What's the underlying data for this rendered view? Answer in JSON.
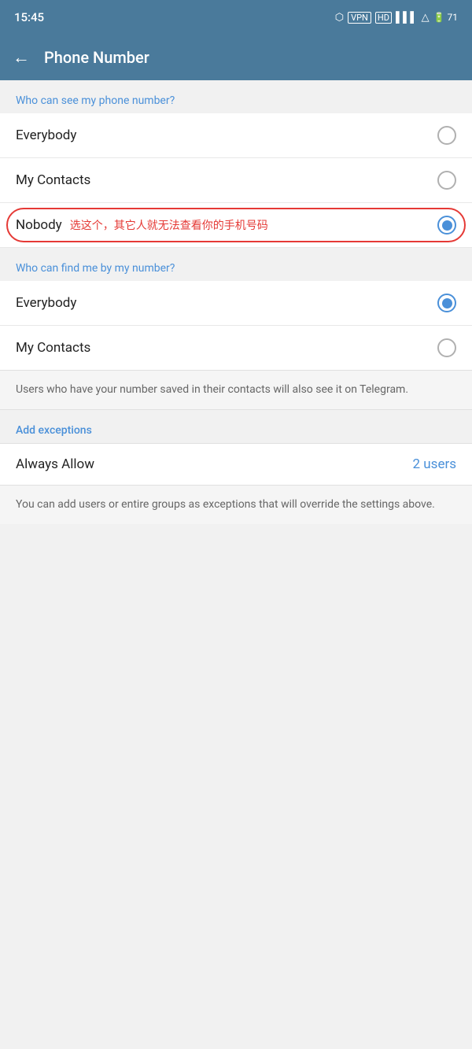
{
  "status": {
    "time": "15:45",
    "icons": "🔷 VPN HD ▌▌ ▲ 71"
  },
  "header": {
    "title": "Phone Number",
    "back_label": "←"
  },
  "section1": {
    "label": "Who can see my phone number?"
  },
  "options_see": [
    {
      "id": "everybody",
      "label": "Everybody",
      "selected": false
    },
    {
      "id": "my_contacts",
      "label": "My Contacts",
      "selected": false
    },
    {
      "id": "nobody",
      "label": "Nobody",
      "selected": true,
      "annotation": "选这个，其它人就无法查看你的手机号码"
    }
  ],
  "section2": {
    "label": "Who can find me by my number?"
  },
  "options_find": [
    {
      "id": "everybody",
      "label": "Everybody",
      "selected": true
    },
    {
      "id": "my_contacts",
      "label": "My Contacts",
      "selected": false
    }
  ],
  "info1": "Users who have your number saved in their contacts will also see it on Telegram.",
  "exceptions": {
    "label": "Add exceptions",
    "always_allow_label": "Always Allow",
    "always_allow_count": "2 users"
  },
  "info2": "You can add users or entire groups as exceptions that will override the settings above."
}
